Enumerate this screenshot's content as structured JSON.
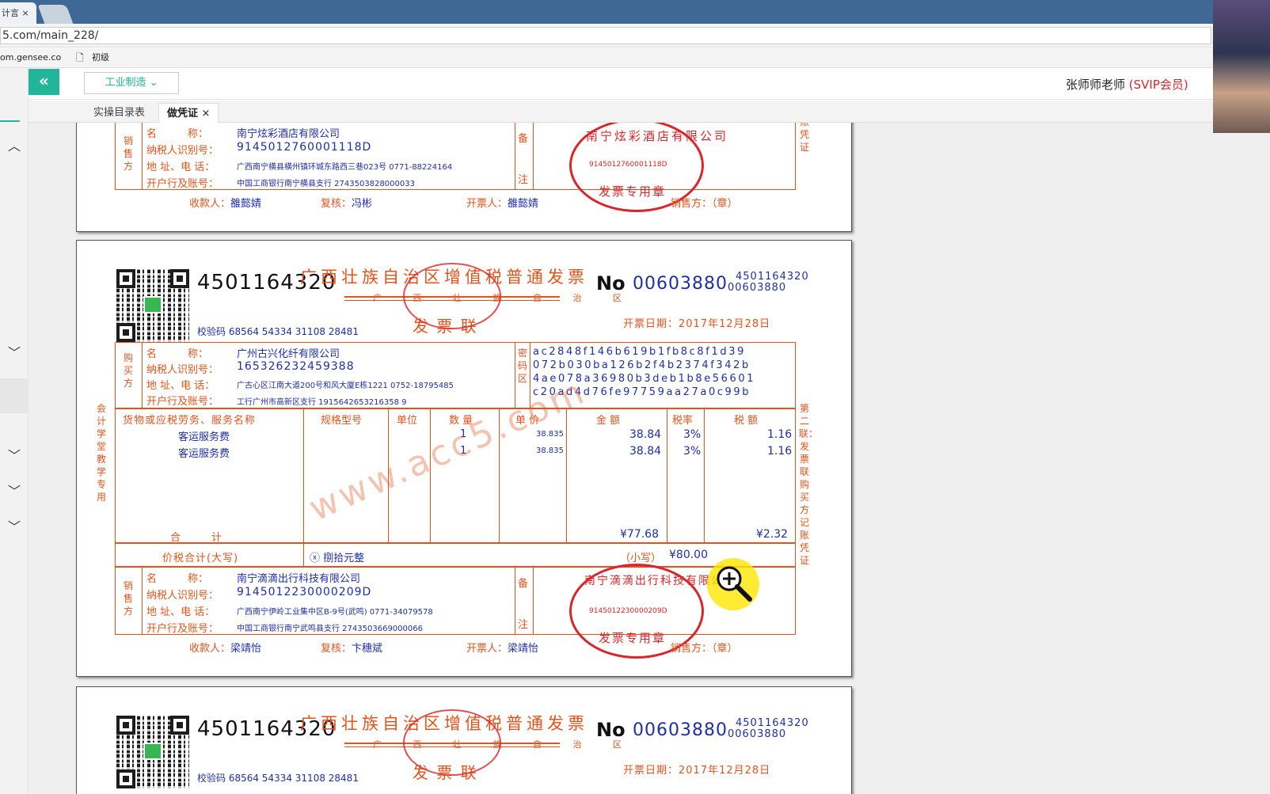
{
  "browser": {
    "tab_title": "计言",
    "tab_close": "×",
    "address": "5.com/main_228/",
    "bookmarks": [
      "om.gensee.co",
      "初级"
    ]
  },
  "app": {
    "industry_select": "工业制造",
    "user_name": "张师师老师",
    "user_level": "(SVIP会员)",
    "back_icon": "«"
  },
  "tabs": [
    {
      "label": "实操目录表"
    },
    {
      "label": "做凭证",
      "close": "×"
    }
  ],
  "invoice_top": {
    "seller_name": "南宁炫彩酒店有限公司",
    "seller_tax_id": "9145012760001118D",
    "seller_address": "广西南宁横县横州镇环城东路西三巷023号 0771-88224164",
    "seller_bank": "中国工商银行南宁横县支行 2743503828000033",
    "payee": "雒懿婧",
    "reviewer": "冯彬",
    "drawer": "雒懿婧",
    "stamp_name": "南宁炫彩酒店有限公司",
    "stamp_tax": "9145012760001118D",
    "stamp_label": "发票专用章",
    "right_side": "账凭证"
  },
  "invoice_main": {
    "code": "4501164320",
    "title": "广西壮族自治区增值税普通发票",
    "sub_title": "广 西 壮 族 自 治 区",
    "copy_name": "发 票 联",
    "no_label": "No",
    "number": "00603880",
    "code_small": "4501164320",
    "number_small": "00603880",
    "check_code": "校验码 68564 54334 31108 28481",
    "date": "开票日期：2017年12月28日",
    "buyer_name": "广州古兴化纤有限公司",
    "buyer_tax_id": "165326232459388",
    "buyer_address": "广古心区江南大道200号和风大厦E栋1221 0752-18795485",
    "buyer_bank": "工行广州市高新区支行 1915642653216358 9",
    "cipher": [
      "ac2848f146b619b1fb8c8f1d39",
      "072b030ba126b2f4b2374f342b",
      "4ae078a36980b3deb1b8e56601",
      "c20ad4d76fe97759aa27a0c99b"
    ],
    "headers": [
      "货物或应税劳务、服务名称",
      "规格型号",
      "单位",
      "数 量",
      "单 价",
      "金  额",
      "税率",
      "税  额"
    ],
    "items": [
      {
        "name": "客运服务费",
        "qty": "1",
        "price": "38.835",
        "amount": "38.84",
        "rate": "3%",
        "tax": "1.16"
      },
      {
        "name": "客运服务费",
        "qty": "1",
        "price": "38.835",
        "amount": "38.84",
        "rate": "3%",
        "tax": "1.16"
      }
    ],
    "total_label": "合　　　计",
    "total_amount": "¥77.68",
    "total_tax": "¥2.32",
    "grand_label": "价税合计(大写)",
    "grand_caps": "ⓧ 捌拾元整",
    "grand_small_label": "（小写）",
    "grand_small": "¥80.00",
    "seller_name": "南宁滴滴出行科技有限公司",
    "seller_tax_id": "9145012230000209D",
    "seller_address": "广西南宁伊岭工业集中区B-9号(武鸣) 0771-34079578",
    "seller_bank": "中国工商银行南宁武鸣县支行 2743503669000066",
    "payee": "梁靖怡",
    "reviewer": "卞穗斌",
    "drawer": "梁靖怡",
    "stamp_name": "南宁滴滴出行科技有限公司",
    "stamp_tax": "9145012230000209D",
    "stamp_label": "发票专用章",
    "left_side": "会计学堂教学专用",
    "right_side": "第二联：发票联 购买方记账凭证",
    "watermark": "www.acc5.com"
  },
  "labels": {
    "name": "名　　　称：",
    "tax_id": "纳税人识别号：",
    "address": "地 址、电 话：",
    "bank": "开户行及账号：",
    "buyer": "购买方",
    "seller": "销售方",
    "cipher": "密码区",
    "remark_top": "备",
    "remark_bottom": "注",
    "payee": "收款人：",
    "reviewer": "复核：",
    "drawer": "开票人：",
    "seller_seal": "销售方：（章）"
  }
}
